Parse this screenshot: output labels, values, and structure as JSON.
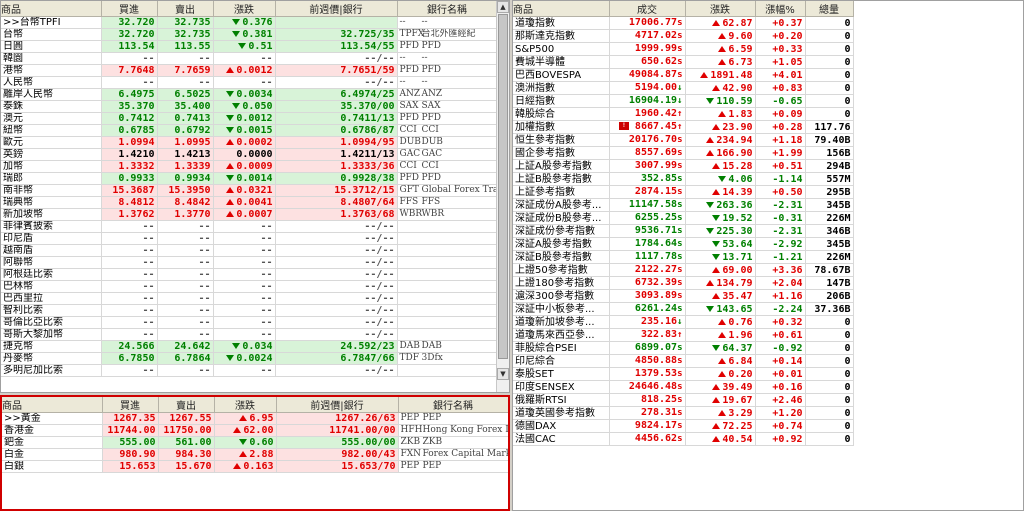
{
  "fx": {
    "headers": [
      "商品",
      "買進",
      "賣出",
      "漲跌",
      "前週價|銀行",
      "銀行名稱"
    ],
    "rows": [
      {
        "name": ">>台幣TPFI",
        "bid": "32.720",
        "ask": "32.735",
        "dir": "down",
        "chg": "0.376",
        "last": "",
        "code": "--",
        "bank": "--",
        "bg": "g"
      },
      {
        "name": "台幣",
        "bid": "32.720",
        "ask": "32.735",
        "dir": "down",
        "chg": "0.381",
        "last": "32.725/35",
        "code": "TPFX",
        "bank": "台北外匯經紀",
        "bg": "g"
      },
      {
        "name": "日圓",
        "bid": "113.54",
        "ask": "113.55",
        "dir": "down",
        "chg": "0.51",
        "last": "113.54/55",
        "code": "PFD",
        "bank": "PFD",
        "bg": "g"
      },
      {
        "name": "韓圜",
        "bid": "--",
        "ask": "--",
        "dir": "none",
        "chg": "--",
        "last": "--/--",
        "code": "--",
        "bank": "--",
        "bg": ""
      },
      {
        "name": "港幣",
        "bid": "7.7648",
        "ask": "7.7659",
        "dir": "up",
        "chg": "0.0012",
        "last": "7.7651/59",
        "code": "PFD",
        "bank": "PFD",
        "bg": "r"
      },
      {
        "name": "人民幣",
        "bid": "--",
        "ask": "--",
        "dir": "none",
        "chg": "--",
        "last": "--/--",
        "code": "--",
        "bank": "--",
        "bg": ""
      },
      {
        "name": "離岸人民幣",
        "bid": "6.4975",
        "ask": "6.5025",
        "dir": "down",
        "chg": "0.0034",
        "last": "6.4974/25",
        "code": "ANZ",
        "bank": "ANZ",
        "bg": "g"
      },
      {
        "name": "泰銖",
        "bid": "35.370",
        "ask": "35.400",
        "dir": "down",
        "chg": "0.050",
        "last": "35.370/00",
        "code": "SAX",
        "bank": "SAX",
        "bg": "g"
      },
      {
        "name": "澳元",
        "bid": "0.7412",
        "ask": "0.7413",
        "dir": "down",
        "chg": "0.0012",
        "last": "0.7411/13",
        "code": "PFD",
        "bank": "PFD",
        "bg": "g"
      },
      {
        "name": "紐幣",
        "bid": "0.6785",
        "ask": "0.6792",
        "dir": "down",
        "chg": "0.0015",
        "last": "0.6786/87",
        "code": "CCI",
        "bank": "CCI",
        "bg": "g"
      },
      {
        "name": "歐元",
        "bid": "1.0994",
        "ask": "1.0995",
        "dir": "up",
        "chg": "0.0002",
        "last": "1.0994/95",
        "code": "DUB",
        "bank": "DUB",
        "bg": "r"
      },
      {
        "name": "英鎊",
        "bid": "1.4210",
        "ask": "1.4213",
        "dir": "flat",
        "chg": "0.0000",
        "last": "1.4211/13",
        "code": "GAC",
        "bank": "GAC",
        "bg": "r"
      },
      {
        "name": "加幣",
        "bid": "1.3332",
        "ask": "1.3339",
        "dir": "up",
        "chg": "0.0009",
        "last": "1.3333/36",
        "code": "CCI",
        "bank": "CCI",
        "bg": "r"
      },
      {
        "name": "瑞郎",
        "bid": "0.9933",
        "ask": "0.9934",
        "dir": "down",
        "chg": "0.0014",
        "last": "0.9928/38",
        "code": "PFD",
        "bank": "PFD",
        "bg": "g"
      },
      {
        "name": "南非幣",
        "bid": "15.3687",
        "ask": "15.3950",
        "dir": "up",
        "chg": "0.0321",
        "last": "15.3712/15",
        "code": "GFT",
        "bank": "Global Forex Trading",
        "bg": "r"
      },
      {
        "name": "瑞典幣",
        "bid": "8.4812",
        "ask": "8.4842",
        "dir": "up",
        "chg": "0.0041",
        "last": "8.4807/64",
        "code": "FFS",
        "bank": "FFS",
        "bg": "r"
      },
      {
        "name": "新加坡幣",
        "bid": "1.3762",
        "ask": "1.3770",
        "dir": "up",
        "chg": "0.0007",
        "last": "1.3763/68",
        "code": "WBR",
        "bank": "WBR",
        "bg": "r"
      },
      {
        "name": "菲律賓披索",
        "bid": "--",
        "ask": "--",
        "dir": "none",
        "chg": "--",
        "last": "--/--",
        "code": "",
        "bank": "",
        "bg": ""
      },
      {
        "name": "印尼盾",
        "bid": "--",
        "ask": "--",
        "dir": "none",
        "chg": "--",
        "last": "--/--",
        "code": "",
        "bank": "",
        "bg": ""
      },
      {
        "name": "越南盾",
        "bid": "--",
        "ask": "--",
        "dir": "none",
        "chg": "--",
        "last": "--/--",
        "code": "",
        "bank": "",
        "bg": ""
      },
      {
        "name": "阿聯幣",
        "bid": "--",
        "ask": "--",
        "dir": "none",
        "chg": "--",
        "last": "--/--",
        "code": "",
        "bank": "",
        "bg": ""
      },
      {
        "name": "阿根廷比索",
        "bid": "--",
        "ask": "--",
        "dir": "none",
        "chg": "--",
        "last": "--/--",
        "code": "",
        "bank": "",
        "bg": ""
      },
      {
        "name": "巴林幣",
        "bid": "--",
        "ask": "--",
        "dir": "none",
        "chg": "--",
        "last": "--/--",
        "code": "",
        "bank": "",
        "bg": ""
      },
      {
        "name": "巴西里拉",
        "bid": "--",
        "ask": "--",
        "dir": "none",
        "chg": "--",
        "last": "--/--",
        "code": "",
        "bank": "",
        "bg": ""
      },
      {
        "name": "智利比索",
        "bid": "--",
        "ask": "--",
        "dir": "none",
        "chg": "--",
        "last": "--/--",
        "code": "",
        "bank": "",
        "bg": ""
      },
      {
        "name": "哥倫比亞比索",
        "bid": "--",
        "ask": "--",
        "dir": "none",
        "chg": "--",
        "last": "--/--",
        "code": "",
        "bank": "",
        "bg": ""
      },
      {
        "name": "哥斯大黎加幣",
        "bid": "--",
        "ask": "--",
        "dir": "none",
        "chg": "--",
        "last": "--/--",
        "code": "",
        "bank": "",
        "bg": ""
      },
      {
        "name": "捷克幣",
        "bid": "24.566",
        "ask": "24.642",
        "dir": "down",
        "chg": "0.034",
        "last": "24.592/23",
        "code": "DAB",
        "bank": "DAB",
        "bg": "g"
      },
      {
        "name": "丹麥幣",
        "bid": "6.7850",
        "ask": "6.7864",
        "dir": "down",
        "chg": "0.0024",
        "last": "6.7847/66",
        "code": "TDF",
        "bank": "3Dfx",
        "bg": "g"
      },
      {
        "name": "多明尼加比索",
        "bid": "--",
        "ask": "--",
        "dir": "none",
        "chg": "--",
        "last": "--/--",
        "code": "",
        "bank": "",
        "bg": ""
      }
    ]
  },
  "metals": {
    "headers": [
      "商品",
      "買進",
      "賣出",
      "漲跌",
      "前週價|銀行",
      "銀行名稱"
    ],
    "rows": [
      {
        "name": ">>黃金",
        "bid": "1267.35",
        "ask": "1267.55",
        "dir": "up",
        "chg": "6.95",
        "last": "1267.26/63",
        "code": "PEP",
        "bank": "PEP",
        "bg": "r"
      },
      {
        "name": "香港金",
        "bid": "11744.00",
        "ask": "11750.00",
        "dir": "up",
        "chg": "62.00",
        "last": "11741.00/00",
        "code": "HFH",
        "bank": "Hong Kong Forex Investm...",
        "bg": "r"
      },
      {
        "name": "鈀金",
        "bid": "555.00",
        "ask": "561.00",
        "dir": "down",
        "chg": "0.60",
        "last": "555.00/00",
        "code": "ZKB",
        "bank": "ZKB",
        "bg": "g"
      },
      {
        "name": "白金",
        "bid": "980.90",
        "ask": "984.30",
        "dir": "up",
        "chg": "2.88",
        "last": "982.00/43",
        "code": "FXN",
        "bank": "Forex Capital Markets",
        "bg": "r"
      },
      {
        "name": "白銀",
        "bid": "15.653",
        "ask": "15.670",
        "dir": "up",
        "chg": "0.163",
        "last": "15.653/70",
        "code": "PEP",
        "bank": "PEP",
        "bg": "r"
      }
    ]
  },
  "indices": {
    "headers": [
      "商品",
      "成交",
      "漲跌",
      "漲幅%",
      "總量"
    ],
    "rows": [
      {
        "name": "道瓊指數",
        "price": "17006.77",
        "suf": "s",
        "arrow": "",
        "dir": "up",
        "chg": "62.87",
        "pct": "+0.37",
        "vol": "0"
      },
      {
        "name": "那斯達克指數",
        "price": "4717.02",
        "suf": "s",
        "arrow": "",
        "dir": "up",
        "chg": "9.60",
        "pct": "+0.20",
        "vol": "0"
      },
      {
        "name": "S&P500",
        "price": "1999.99",
        "suf": "s",
        "arrow": "",
        "dir": "up",
        "chg": "6.59",
        "pct": "+0.33",
        "vol": "0"
      },
      {
        "name": "費城半導體",
        "price": "650.62",
        "suf": "s",
        "arrow": "",
        "dir": "up",
        "chg": "6.73",
        "pct": "+1.05",
        "vol": "0"
      },
      {
        "name": "巴西BOVESPA",
        "price": "49084.87",
        "suf": "s",
        "arrow": "",
        "dir": "up",
        "chg": "1891.48",
        "pct": "+4.01",
        "vol": "0"
      },
      {
        "name": "澳洲指數",
        "price": "5194.00",
        "suf": "",
        "arrow": "dn",
        "dir": "up",
        "chg": "42.90",
        "pct": "+0.83",
        "vol": "0"
      },
      {
        "name": "日經指數",
        "price": "16904.19",
        "suf": "",
        "arrow": "dn",
        "dir": "down",
        "chg": "110.59",
        "pct": "-0.65",
        "vol": "0"
      },
      {
        "name": "韓股綜合",
        "price": "1960.42",
        "suf": "",
        "arrow": "up",
        "dir": "up",
        "chg": "1.83",
        "pct": "+0.09",
        "vol": "0"
      },
      {
        "name": "加權指數",
        "price": "8667.45",
        "suf": "",
        "arrow": "up",
        "dir": "up",
        "chg": "23.90",
        "pct": "+0.28",
        "vol": "117.76",
        "flag": "!"
      },
      {
        "name": "恒生參考指數",
        "price": "20176.70",
        "suf": "s",
        "arrow": "",
        "dir": "up",
        "chg": "234.94",
        "pct": "+1.18",
        "vol": "79.40B"
      },
      {
        "name": "國企參考指數",
        "price": "8557.69",
        "suf": "s",
        "arrow": "",
        "dir": "up",
        "chg": "166.90",
        "pct": "+1.99",
        "vol": "156B"
      },
      {
        "name": "上証A股參考指數",
        "price": "3007.99",
        "suf": "s",
        "arrow": "",
        "dir": "up",
        "chg": "15.28",
        "pct": "+0.51",
        "vol": "294B"
      },
      {
        "name": "上証B股參考指數",
        "price": "352.85",
        "suf": "s",
        "arrow": "",
        "dir": "down",
        "chg": "4.06",
        "pct": "-1.14",
        "vol": "557M"
      },
      {
        "name": "上証參考指數",
        "price": "2874.15",
        "suf": "s",
        "arrow": "",
        "dir": "up",
        "chg": "14.39",
        "pct": "+0.50",
        "vol": "295B"
      },
      {
        "name": "深証成份A股參考...",
        "price": "11147.58",
        "suf": "s",
        "arrow": "",
        "dir": "down",
        "chg": "263.36",
        "pct": "-2.31",
        "vol": "345B"
      },
      {
        "name": "深証成份B股參考...",
        "price": "6255.25",
        "suf": "s",
        "arrow": "",
        "dir": "down",
        "chg": "19.52",
        "pct": "-0.31",
        "vol": "226M"
      },
      {
        "name": "深証成份參考指數",
        "price": "9536.71",
        "suf": "s",
        "arrow": "",
        "dir": "down",
        "chg": "225.30",
        "pct": "-2.31",
        "vol": "346B"
      },
      {
        "name": "深証A股參考指數",
        "price": "1784.64",
        "suf": "s",
        "arrow": "",
        "dir": "down",
        "chg": "53.64",
        "pct": "-2.92",
        "vol": "345B"
      },
      {
        "name": "深証B股參考指數",
        "price": "1117.78",
        "suf": "s",
        "arrow": "",
        "dir": "down",
        "chg": "13.71",
        "pct": "-1.21",
        "vol": "226M"
      },
      {
        "name": "上證50參考指數",
        "price": "2122.27",
        "suf": "s",
        "arrow": "",
        "dir": "up",
        "chg": "69.00",
        "pct": "+3.36",
        "vol": "78.67B"
      },
      {
        "name": "上證180參考指數",
        "price": "6732.39",
        "suf": "s",
        "arrow": "",
        "dir": "up",
        "chg": "134.79",
        "pct": "+2.04",
        "vol": "147B"
      },
      {
        "name": "滬深300參考指數",
        "price": "3093.89",
        "suf": "s",
        "arrow": "",
        "dir": "up",
        "chg": "35.47",
        "pct": "+1.16",
        "vol": "206B"
      },
      {
        "name": "深証中小板參考...",
        "price": "6261.24",
        "suf": "s",
        "arrow": "",
        "dir": "down",
        "chg": "143.65",
        "pct": "-2.24",
        "vol": "37.36B"
      },
      {
        "name": "道瓊新加坡參考...",
        "price": "235.16",
        "suf": "",
        "arrow": "dn",
        "dir": "up",
        "chg": "0.76",
        "pct": "+0.32",
        "vol": "0"
      },
      {
        "name": "道瓊馬來西亞參...",
        "price": "322.83",
        "suf": "",
        "arrow": "up",
        "dir": "up",
        "chg": "1.96",
        "pct": "+0.61",
        "vol": "0"
      },
      {
        "name": "菲股綜合PSEI",
        "price": "6899.07",
        "suf": "s",
        "arrow": "",
        "dir": "down",
        "chg": "64.37",
        "pct": "-0.92",
        "vol": "0"
      },
      {
        "name": "印尼綜合",
        "price": "4850.88",
        "suf": "s",
        "arrow": "",
        "dir": "up",
        "chg": "6.84",
        "pct": "+0.14",
        "vol": "0"
      },
      {
        "name": "泰股SET",
        "price": "1379.53",
        "suf": "s",
        "arrow": "",
        "dir": "up",
        "chg": "0.20",
        "pct": "+0.01",
        "vol": "0"
      },
      {
        "name": "印度SENSEX",
        "price": "24646.48",
        "suf": "s",
        "arrow": "",
        "dir": "up",
        "chg": "39.49",
        "pct": "+0.16",
        "vol": "0"
      },
      {
        "name": "俄羅斯RTSI",
        "price": "818.25",
        "suf": "s",
        "arrow": "",
        "dir": "up",
        "chg": "19.67",
        "pct": "+2.46",
        "vol": "0"
      },
      {
        "name": "道瓊英國參考指數",
        "price": "278.31",
        "suf": "s",
        "arrow": "",
        "dir": "up",
        "chg": "3.29",
        "pct": "+1.20",
        "vol": "0"
      },
      {
        "name": "德國DAX",
        "price": "9824.17",
        "suf": "s",
        "arrow": "",
        "dir": "up",
        "chg": "72.25",
        "pct": "+0.74",
        "vol": "0"
      },
      {
        "name": "法國CAC",
        "price": "4456.62",
        "suf": "s",
        "arrow": "",
        "dir": "up",
        "chg": "40.54",
        "pct": "+0.92",
        "vol": "0"
      }
    ]
  },
  "colors": {
    "up": "#e00000",
    "down": "#008000",
    "grid": "#d8d8d8",
    "header": "#ece9d8",
    "active_border": "#d00000"
  }
}
